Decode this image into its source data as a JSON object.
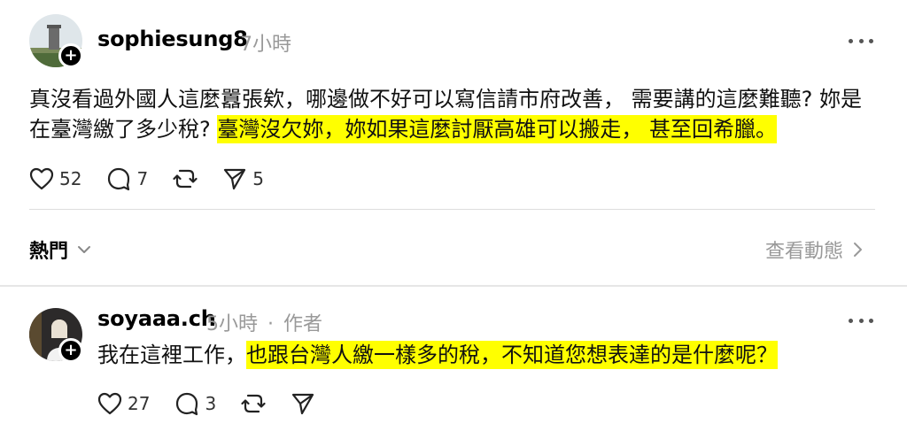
{
  "post": {
    "username": "sophiesung8",
    "time": "7小時",
    "text_plain": "真沒看過外國人這麼囂張欸，哪邊做不好可以寫信請市府改善， 需要講的這麼難聽? 妳是在臺灣繳了多少稅? ",
    "text_highlight": "臺灣沒欠妳，妳如果這麼討厭高雄可以搬走， 甚至回希臘。",
    "likes": "52",
    "comments": "7",
    "shares": "5"
  },
  "sort": {
    "label": "熱門",
    "view_activity": "查看動態"
  },
  "reply": {
    "username": "soyaaa.ch",
    "time": "5小時",
    "separator": "·",
    "author_badge": "作者",
    "text_plain": "我在這裡工作，",
    "text_highlight": "也跟台灣人繳一樣多的稅，不知道您想表達的是什麼呢？",
    "likes": "27",
    "comments": "3"
  },
  "colors": {
    "highlight": "#ffff00",
    "muted": "#999999"
  }
}
